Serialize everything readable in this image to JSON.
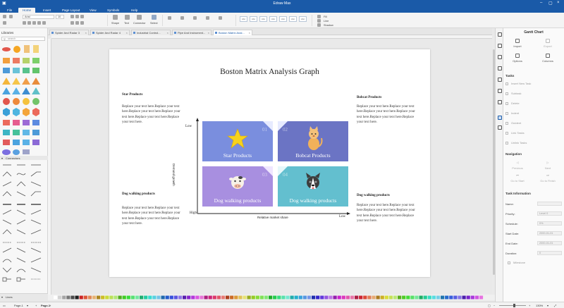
{
  "window": {
    "title": "Edraw Max"
  },
  "menu": {
    "items": [
      "File",
      "Home",
      "Insert",
      "Page Layout",
      "View",
      "Symbols",
      "Help"
    ],
    "active": "Home"
  },
  "ribbon": {
    "font_name": "Arial",
    "font_size": "10",
    "tools": [
      "Shape",
      "Text",
      "Connector",
      "Select"
    ],
    "style_swatches": [
      "Abc",
      "Abc",
      "Abc",
      "Abc",
      "Abc",
      "Abc",
      "Abc"
    ],
    "right_tools": [
      "Fill",
      "Line",
      "Shadow"
    ]
  },
  "libraries": {
    "title": "Libraries",
    "search_placeholder": "search",
    "connectors_label": "Connectors",
    "lines_label": "Lines"
  },
  "tabs": [
    {
      "label": "Spider And Radar 3"
    },
    {
      "label": "Spider And Radar 4"
    },
    {
      "label": "Industrial Control..."
    },
    {
      "label": "Pipe And Instrument..."
    },
    {
      "label": "Boston Matrix Anal..."
    }
  ],
  "diagram": {
    "title": "Boston Matrix Analysis Graph",
    "placeholder": "Replace your text here.Replace your text here.Replace your text here.Replace your text here.Replace your text here.Replace your text here.",
    "sections": {
      "star": "Star Products",
      "bobcat": "Bobcat Products",
      "dog_left": "Dog walking products",
      "dog_right": "Dog walking products"
    },
    "quadrants": [
      {
        "label": "Star Products",
        "num": "01"
      },
      {
        "label": "Bobcat Products",
        "num": "02"
      },
      {
        "label": "Dog walking products",
        "num": "03"
      },
      {
        "label": "Dog walking products",
        "num": "04"
      }
    ],
    "axis": {
      "low_y": "Low",
      "high_y": "High",
      "low_x": "Low",
      "x_title": "Relative market share",
      "y_title": "Demand growth"
    },
    "colors": {
      "q1": "#7a8ede",
      "q2": "#6b74c4",
      "q3": "#a88fe0",
      "q4": "#63bfcf"
    }
  },
  "gantt": {
    "title": "Gantt Chart",
    "top_buttons": [
      "Import",
      "Export",
      "Options",
      "Columns"
    ],
    "tasks_label": "Tasks",
    "task_items": [
      "Insert New Task",
      "Subtask",
      "Delete",
      "Indent",
      "Outdent",
      "Link Tasks",
      "Unlink Tasks"
    ],
    "navigation_label": "Navigation",
    "nav_buttons": [
      "Previous",
      "Next",
      "Go to Start",
      "Go to Finish"
    ],
    "info_label": "Task Information",
    "fields": [
      {
        "label": "Name:",
        "value": ""
      },
      {
        "label": "Priority:",
        "value": "Level 0"
      },
      {
        "label": "Schedule:",
        "value": "0%"
      },
      {
        "label": "Start Date:",
        "value": "2000-01-01"
      },
      {
        "label": "End Date:",
        "value": "2000-01-01"
      },
      {
        "label": "Duration:",
        "value": "0"
      }
    ],
    "milestone_label": "Milestone"
  },
  "status": {
    "page_select": "Page-1",
    "page_tab": "Page-1",
    "zoom": "130%"
  }
}
